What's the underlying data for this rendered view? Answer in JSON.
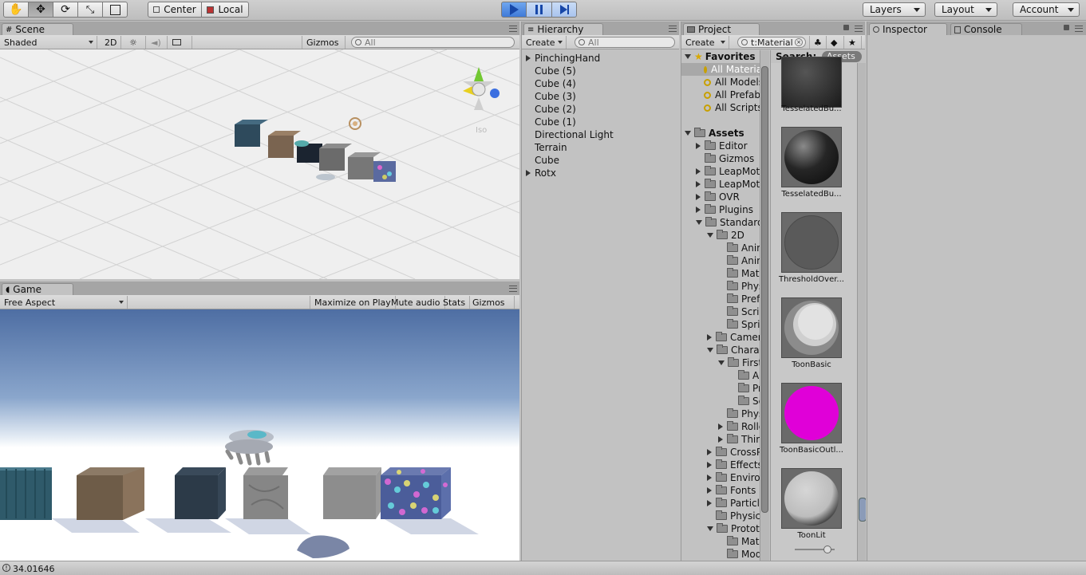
{
  "toolbar": {
    "transform_tools": [
      "hand-tool",
      "move-tool",
      "rotate-tool",
      "scale-tool",
      "rect-tool"
    ],
    "pivot_label": "Center",
    "space_label": "Local",
    "layers_label": "Layers",
    "layout_label": "Layout",
    "account_label": "Account"
  },
  "scene": {
    "tab_label": "Scene",
    "shading": "Shaded",
    "mode_2d": "2D",
    "gizmos": "Gizmos",
    "search_placeholder": "All",
    "iso_label": "Iso"
  },
  "game": {
    "tab_label": "Game",
    "aspect": "Free Aspect",
    "buttons": [
      "Maximize on Play",
      "Mute audio",
      "Stats",
      "Gizmos"
    ]
  },
  "hierarchy": {
    "tab_label": "Hierarchy",
    "create_label": "Create",
    "search_placeholder": "All",
    "items": [
      {
        "label": "PinchingHand",
        "expandable": true
      },
      {
        "label": "Cube (5)",
        "expandable": false
      },
      {
        "label": "Cube (4)",
        "expandable": false
      },
      {
        "label": "Cube (3)",
        "expandable": false
      },
      {
        "label": "Cube (2)",
        "expandable": false
      },
      {
        "label": "Cube (1)",
        "expandable": false
      },
      {
        "label": "Directional Light",
        "expandable": false
      },
      {
        "label": "Terrain",
        "expandable": false
      },
      {
        "label": "Cube",
        "expandable": false
      },
      {
        "label": "Rotx",
        "expandable": true
      }
    ]
  },
  "project": {
    "tab_label": "Project",
    "create_label": "Create",
    "search_value": "t:Material",
    "search_label": "Search:",
    "search_scope": "Assets",
    "favorites_label": "Favorites",
    "favorites": [
      "All Materials",
      "All Models",
      "All Prefabs",
      "All Scripts"
    ],
    "assets_label": "Assets",
    "tree": [
      {
        "label": "Editor",
        "depth": 1,
        "state": "collapsed"
      },
      {
        "label": "Gizmos",
        "depth": 1,
        "state": "leaf"
      },
      {
        "label": "LeapMotion",
        "depth": 1,
        "state": "collapsed"
      },
      {
        "label": "LeapMotionModules",
        "depth": 1,
        "state": "collapsed"
      },
      {
        "label": "OVR",
        "depth": 1,
        "state": "collapsed"
      },
      {
        "label": "Plugins",
        "depth": 1,
        "state": "collapsed"
      },
      {
        "label": "Standard Assets",
        "depth": 1,
        "state": "expanded"
      },
      {
        "label": "2D",
        "depth": 2,
        "state": "expanded"
      },
      {
        "label": "Animations",
        "depth": 3,
        "state": "leaf"
      },
      {
        "label": "Animator",
        "depth": 3,
        "state": "leaf"
      },
      {
        "label": "Materials",
        "depth": 3,
        "state": "leaf"
      },
      {
        "label": "PhysicsMaterials",
        "depth": 3,
        "state": "leaf"
      },
      {
        "label": "Prefabs",
        "depth": 3,
        "state": "leaf"
      },
      {
        "label": "Scripts",
        "depth": 3,
        "state": "leaf"
      },
      {
        "label": "Sprites",
        "depth": 3,
        "state": "leaf"
      },
      {
        "label": "Cameras",
        "depth": 2,
        "state": "collapsed"
      },
      {
        "label": "Characters",
        "depth": 2,
        "state": "expanded"
      },
      {
        "label": "FirstPersonCharacter",
        "depth": 3,
        "state": "expanded"
      },
      {
        "label": "Audio",
        "depth": 4,
        "state": "leaf"
      },
      {
        "label": "Prefabs",
        "depth": 4,
        "state": "leaf"
      },
      {
        "label": "Scripts",
        "depth": 4,
        "state": "leaf"
      },
      {
        "label": "PhysicsMaterials",
        "depth": 3,
        "state": "leaf"
      },
      {
        "label": "RollerBall",
        "depth": 3,
        "state": "collapsed"
      },
      {
        "label": "ThirdPersonCharacter",
        "depth": 3,
        "state": "collapsed"
      },
      {
        "label": "CrossPlatformInput",
        "depth": 2,
        "state": "collapsed"
      },
      {
        "label": "Effects",
        "depth": 2,
        "state": "collapsed"
      },
      {
        "label": "Environment",
        "depth": 2,
        "state": "collapsed"
      },
      {
        "label": "Fonts",
        "depth": 2,
        "state": "collapsed"
      },
      {
        "label": "ParticleSystems",
        "depth": 2,
        "state": "collapsed"
      },
      {
        "label": "PhysicsMaterials",
        "depth": 2,
        "state": "leaf"
      },
      {
        "label": "Prototyping",
        "depth": 2,
        "state": "expanded"
      },
      {
        "label": "Materials",
        "depth": 3,
        "state": "leaf"
      },
      {
        "label": "Models",
        "depth": 3,
        "state": "leaf"
      }
    ],
    "materials": [
      {
        "label": "TesselatedBu...",
        "kind": "bumpy"
      },
      {
        "label": "TesselatedBu...",
        "kind": "dark-sphere"
      },
      {
        "label": "ThresholdOver...",
        "kind": "gray-flat"
      },
      {
        "label": "ToonBasic",
        "kind": "toon"
      },
      {
        "label": "ToonBasicOutl...",
        "kind": "magenta"
      },
      {
        "label": "ToonLit",
        "kind": "toonlit"
      }
    ]
  },
  "inspector": {
    "tab_label": "Inspector",
    "console_label": "Console"
  },
  "status": {
    "message": "34.01646"
  },
  "colors": {
    "play_active": "#3f7ad8",
    "sky_top": "#4e6ea3",
    "magenta": "#e000d8"
  }
}
